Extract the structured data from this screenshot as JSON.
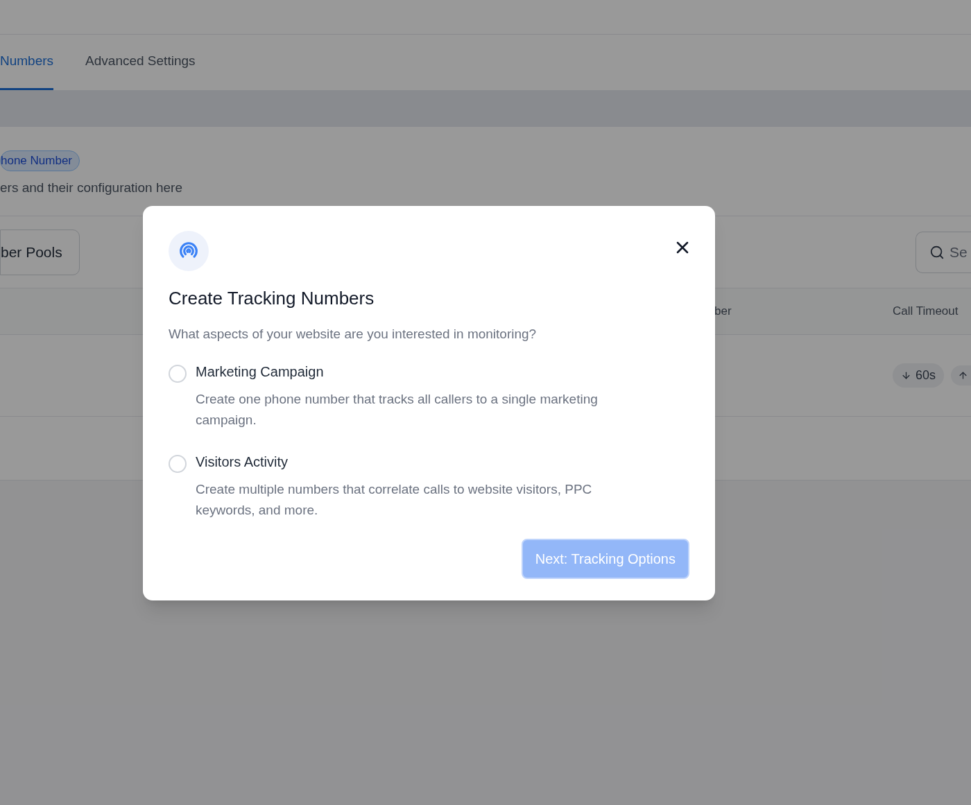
{
  "tabs": [
    {
      "label": "Numbers",
      "selected": true
    },
    {
      "label": "Advanced Settings",
      "selected": false
    }
  ],
  "section": {
    "badge": "hone Number",
    "description": "ers and their configuration here"
  },
  "toolbar": {
    "button": "ber Pools",
    "search": {
      "placeholder": "Se"
    }
  },
  "table": {
    "columns": [
      "ber",
      "Call Timeout"
    ],
    "rows": [
      {
        "call_timeout": "60s"
      }
    ]
  },
  "modal": {
    "title": "Create Tracking Numbers",
    "subtitle": "What aspects of your website are you interested in monitoring?",
    "options": [
      {
        "label": "Marketing Campaign",
        "description": "Create one phone number that tracks all callers to a single marketing campaign.",
        "selected": false
      },
      {
        "label": "Visitors Activity",
        "description": "Create multiple numbers that correlate calls to website visitors, PPC keywords, and more.",
        "selected": false
      }
    ],
    "next_button": {
      "label": "Next: Tracking Options",
      "disabled": true
    }
  }
}
